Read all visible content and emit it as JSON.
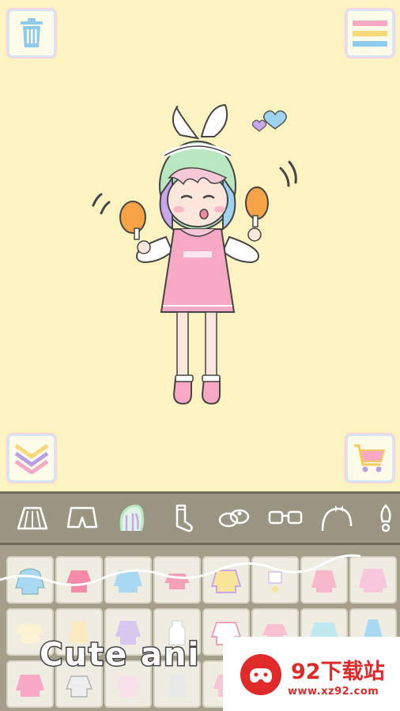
{
  "icons": {
    "trash": "trash-icon",
    "menu": "menu-icon",
    "collapse": "chevron-down-icon",
    "shop": "cart-icon"
  },
  "toolbar": {
    "categories": [
      "skirt",
      "shorts",
      "hair",
      "socks",
      "shoes",
      "glasses",
      "headband",
      "accessory"
    ],
    "selected": "hair"
  },
  "tray": {
    "rows": 3,
    "columns": 8
  },
  "caption": {
    "text": "Cute ani"
  },
  "watermark": {
    "name": "92下载站",
    "url": "www.xz92.com"
  },
  "colors": {
    "background": "#fdf2c2",
    "toolbar": "#9a9583",
    "tray": "#a49f8b",
    "pink": "#f7a8c4",
    "blue": "#9fd4f0",
    "watermark": "#e02a2a"
  }
}
